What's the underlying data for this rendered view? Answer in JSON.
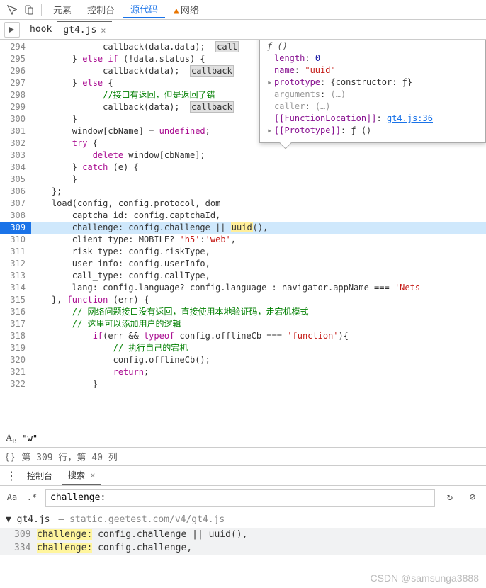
{
  "toolbar": {
    "tabs": [
      "元素",
      "控制台",
      "源代码",
      "网络"
    ],
    "active": 2,
    "network_warn": true
  },
  "src_tabs": {
    "breadcrumb": "hook",
    "active_file": "gt4.js"
  },
  "tooltip": {
    "header": "ƒ ()",
    "rows": [
      {
        "key": "length",
        "val": "0",
        "tint": "val"
      },
      {
        "key": "name",
        "val": "\"uuid\"",
        "tint": "str"
      },
      {
        "arrow": "▸",
        "key": "prototype",
        "val": "{constructor: ƒ}"
      },
      {
        "key": "arguments",
        "val": "(…)",
        "muted": true
      },
      {
        "key": "caller",
        "val": "(…)",
        "muted": true
      },
      {
        "key": "[[FunctionLocation]]",
        "link": "gt4.js:36"
      },
      {
        "arrow": "▸",
        "key": "[[Prototype]]",
        "val": "ƒ ()"
      }
    ]
  },
  "code": {
    "first_line": 294,
    "highlight_line": 309,
    "lines": [
      {
        "n": 294,
        "html": "            callback(data.data);  <span class='hl-tok'>call</span>"
      },
      {
        "n": 295,
        "html": "      } <span class='kw'>else if</span> (!data.status) {"
      },
      {
        "n": 296,
        "html": "            callback(data);  <span class='hl-tok'>callback</span>"
      },
      {
        "n": 297,
        "html": "      } <span class='kw'>else</span> {"
      },
      {
        "n": 298,
        "html": "            <span class='com'>//接口有返回，但是返回了错</span>"
      },
      {
        "n": 299,
        "html": "            callback(data);  <span class='hl-tok'>callback</span>"
      },
      {
        "n": 300,
        "html": "      }"
      },
      {
        "n": 301,
        "html": "      window[cbName] = <span class='kw'>undefined</span>;"
      },
      {
        "n": 302,
        "html": "      <span class='kw'>try</span> {"
      },
      {
        "n": 303,
        "html": "          <span class='kw'>delete</span> window[cbName];"
      },
      {
        "n": 304,
        "html": "      } <span class='kw'>catch</span> (e) {"
      },
      {
        "n": 305,
        "html": "      }"
      },
      {
        "n": 306,
        "html": "  };"
      },
      {
        "n": 307,
        "html": "  load(config, config.protocol, dom"
      },
      {
        "n": 308,
        "html": "      captcha_id: config.captchaId,"
      },
      {
        "n": 309,
        "html": "      challenge: config.challenge || <span class='hl-uuid'>uuid</span>(),"
      },
      {
        "n": 310,
        "html": "      client_type: MOBILE? <span class='str'>'h5'</span>:<span class='str'>'web'</span>,"
      },
      {
        "n": 311,
        "html": "      risk_type: config.riskType,"
      },
      {
        "n": 312,
        "html": "      user_info: config.userInfo,"
      },
      {
        "n": 313,
        "html": "      call_type: config.callType,"
      },
      {
        "n": 314,
        "html": "      lang: config.language? config.language : navigator.appName === <span class='str'>'Nets</span>"
      },
      {
        "n": 315,
        "html": "  }, <span class='kw'>function</span> (err) {"
      },
      {
        "n": 316,
        "html": "      <span class='com'>// 网络问题接口没有返回，直接使用本地验证码，走宕机模式</span>"
      },
      {
        "n": 317,
        "html": "      <span class='com'>// 这里可以添加用户的逻辑</span>"
      },
      {
        "n": 318,
        "html": "          <span class='kw'>if</span>(err && <span class='kw'>typeof</span> config.offlineCb === <span class='str'>'function'</span>){"
      },
      {
        "n": 319,
        "html": "              <span class='com'>// 执行自己的宕机</span>"
      },
      {
        "n": 320,
        "html": "              config.offlineCb();"
      },
      {
        "n": 321,
        "html": "              <span class='kw'>return</span>;"
      },
      {
        "n": 322,
        "html": "          }"
      }
    ]
  },
  "search_expr": {
    "value": "\"w\""
  },
  "cursor_info": "第 309 行，第 40 列",
  "search_panel": {
    "console_label": "控制台",
    "search_label": "搜索",
    "query": "challenge:",
    "file": "gt4.js",
    "file_path": "static.geetest.com/v4/gt4.js",
    "results": [
      {
        "line": 309,
        "match": "challenge:",
        "rest": " config.challenge || uuid(),"
      },
      {
        "line": 334,
        "match": "challenge:",
        "rest": " config.challenge,"
      }
    ]
  },
  "watermark": "CSDN @samsunga3888"
}
